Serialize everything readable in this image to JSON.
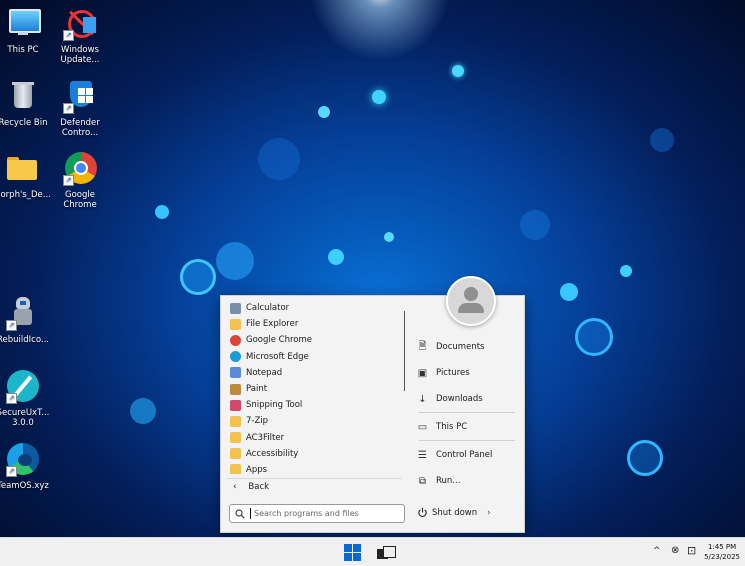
{
  "desktop": {
    "icons": [
      {
        "label": "This PC",
        "icon": "monitor-icon"
      },
      {
        "label": "Windows Update...",
        "icon": "windows-update-icon"
      },
      {
        "label": "Recycle Bin",
        "icon": "recycle-bin-icon"
      },
      {
        "label": "Defender Contro...",
        "icon": "defender-shield-icon"
      },
      {
        "label": "Morph's_De...",
        "icon": "folder-icon"
      },
      {
        "label": "Google Chrome",
        "icon": "chrome-icon"
      },
      {
        "label": "RebuildIco...",
        "icon": "robot-icon"
      },
      {
        "label": "SecureUxT... 3.0.0",
        "icon": "pen-icon"
      },
      {
        "label": "TeamOS.xyz",
        "icon": "edge-icon"
      }
    ]
  },
  "start_menu": {
    "programs": [
      {
        "label": "Calculator",
        "icon": "calculator-icon",
        "color": "#7a8da8"
      },
      {
        "label": "File Explorer",
        "icon": "file-explorer-icon",
        "color": "#f2c14e"
      },
      {
        "label": "Google Chrome",
        "icon": "chrome-icon",
        "color": "#db4437"
      },
      {
        "label": "Microsoft Edge",
        "icon": "edge-icon",
        "color": "#1a9ad6"
      },
      {
        "label": "Notepad",
        "icon": "notepad-icon",
        "color": "#5b8bd6"
      },
      {
        "label": "Paint",
        "icon": "paint-icon",
        "color": "#c08a3e"
      },
      {
        "label": "Snipping Tool",
        "icon": "snipping-tool-icon",
        "color": "#d24a6b"
      },
      {
        "label": "7-Zip",
        "icon": "folder-icon",
        "color": "#f2c14e"
      },
      {
        "label": "AC3Filter",
        "icon": "folder-icon",
        "color": "#f2c14e"
      },
      {
        "label": "Accessibility",
        "icon": "folder-icon",
        "color": "#f2c14e"
      },
      {
        "label": "Apps",
        "icon": "folder-icon",
        "color": "#f2c14e"
      }
    ],
    "back_label": "Back",
    "right_items": [
      {
        "label": "Documents",
        "icon": "document-icon"
      },
      {
        "label": "Pictures",
        "icon": "picture-icon"
      },
      {
        "label": "Downloads",
        "icon": "download-icon"
      },
      {
        "label": "This PC",
        "icon": "monitor-icon"
      },
      {
        "label": "Control Panel",
        "icon": "control-panel-icon"
      },
      {
        "label": "Run...",
        "icon": "run-icon"
      }
    ],
    "search_placeholder": "Search programs and files",
    "shutdown_label": "Shut down"
  },
  "taskbar": {
    "time": "1:45 PM",
    "date": "5/23/2025"
  }
}
